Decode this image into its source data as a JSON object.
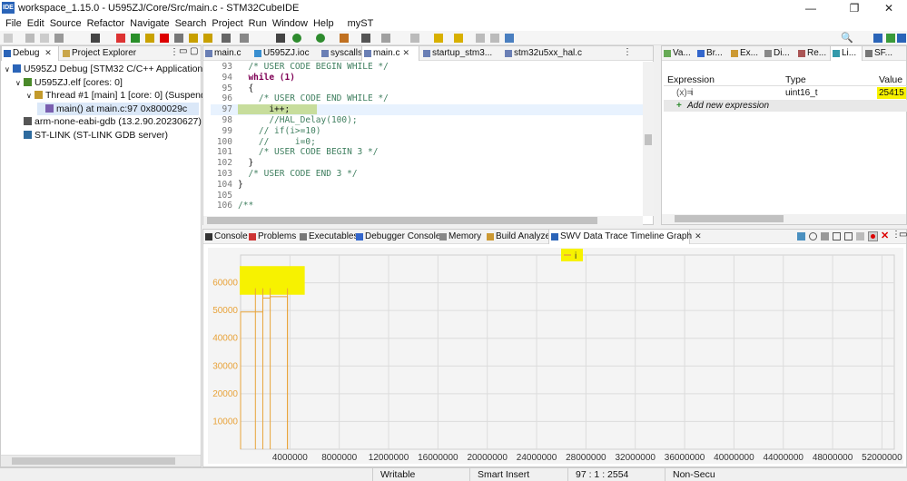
{
  "window": {
    "logo": "IDE",
    "title": "workspace_1.15.0 - U595ZJ/Core/Src/main.c - STM32CubeIDE",
    "minimize": "—",
    "maximize": "❐",
    "close": "✕"
  },
  "menu": [
    "File",
    "Edit",
    "Source",
    "Refactor",
    "Navigate",
    "Search",
    "Project",
    "Run",
    "Window",
    "Help",
    "myST"
  ],
  "debug_panel": {
    "tabs": [
      {
        "label": "Debug",
        "active": true
      },
      {
        "label": "Project Explorer",
        "active": false
      }
    ],
    "tree": [
      {
        "label": "U595ZJ Debug [STM32 C/C++ Application]",
        "indent": 0,
        "expander": "∨"
      },
      {
        "label": "U595ZJ.elf [cores: 0]",
        "indent": 1,
        "expander": "∨"
      },
      {
        "label": "Thread #1 [main] 1 [core: 0] (Suspended :",
        "indent": 2,
        "expander": "∨"
      },
      {
        "label": "main() at main.c:97 0x800029c",
        "indent": 3,
        "expander": "",
        "selected": true
      },
      {
        "label": "arm-none-eabi-gdb (13.2.90.20230627)",
        "indent": 1,
        "expander": ""
      },
      {
        "label": "ST-LINK (ST-LINK GDB server)",
        "indent": 1,
        "expander": ""
      }
    ]
  },
  "editor": {
    "tabs": [
      "main.c",
      "U595ZJ.ioc",
      "syscalls.c",
      "main.c",
      "startup_stm3...",
      "stm32u5xx_hal.c"
    ],
    "active_tab": 3,
    "lines": [
      {
        "num": "93",
        "text": "  /* USER CODE BEGIN WHILE */",
        "kind": "comment"
      },
      {
        "num": "94",
        "text": "  while (1)",
        "kind": "keyword"
      },
      {
        "num": "95",
        "text": "  {",
        "kind": "code"
      },
      {
        "num": "96",
        "text": "    /* USER CODE END WHILE */",
        "kind": "comment"
      },
      {
        "num": "97",
        "text": "      i++;",
        "kind": "current"
      },
      {
        "num": "98",
        "text": "      //HAL_Delay(100);",
        "kind": "comment"
      },
      {
        "num": "99",
        "text": "    // if(i>=10)",
        "kind": "comment"
      },
      {
        "num": "100",
        "text": "    //     i=0;",
        "kind": "comment"
      },
      {
        "num": "101",
        "text": "    /* USER CODE BEGIN 3 */",
        "kind": "comment"
      },
      {
        "num": "102",
        "text": "  }",
        "kind": "code"
      },
      {
        "num": "103",
        "text": "  /* USER CODE END 3 */",
        "kind": "comment"
      },
      {
        "num": "104",
        "text": "}",
        "kind": "code"
      },
      {
        "num": "105",
        "text": "",
        "kind": "code"
      },
      {
        "num": "106",
        "text": "/**",
        "kind": "comment"
      }
    ]
  },
  "expressions_panel": {
    "tabs": [
      "Va...",
      "Br...",
      "Ex...",
      "Di...",
      "Re...",
      "Li...",
      "SF..."
    ],
    "columns": [
      "Expression",
      "Type",
      "Value"
    ],
    "rows": [
      {
        "expression": "i",
        "type": "uint16_t",
        "value": "25415"
      }
    ],
    "add_label": "Add new expression"
  },
  "bottom_panel": {
    "tabs": [
      "Console",
      "Problems",
      "Executables",
      "Debugger Console",
      "Memory",
      "Build Analyzer",
      "SWV Data Trace Timeline Graph"
    ],
    "active_tab": 6
  },
  "chart_data": {
    "type": "line",
    "legend": [
      "i"
    ],
    "legend_position": "top-center",
    "xlim": [
      0,
      53000000
    ],
    "ylim": [
      0,
      70000
    ],
    "x_ticks": [
      "4000000",
      "8000000",
      "12000000",
      "16000000",
      "20000000",
      "24000000",
      "28000000",
      "32000000",
      "36000000",
      "40000000",
      "44000000",
      "48000000",
      "52000000"
    ],
    "y_ticks": [
      "10000",
      "20000",
      "30000",
      "40000",
      "50000",
      "60000"
    ],
    "grid": true,
    "series": [
      {
        "name": "i",
        "x": [
          0,
          0,
          1800000,
          1800000,
          2400000,
          2400000,
          3800000,
          3800000
        ],
        "y": [
          0,
          49500,
          49500,
          54500,
          54500,
          55000,
          55000,
          0
        ]
      }
    ],
    "colors": {
      "line": "#e8a33a",
      "highlight": "#f7f200"
    }
  },
  "status_bar": {
    "writable": "Writable",
    "insert_mode": "Smart Insert",
    "position": "97 : 1 : 2554",
    "security": "Non-Secu"
  }
}
